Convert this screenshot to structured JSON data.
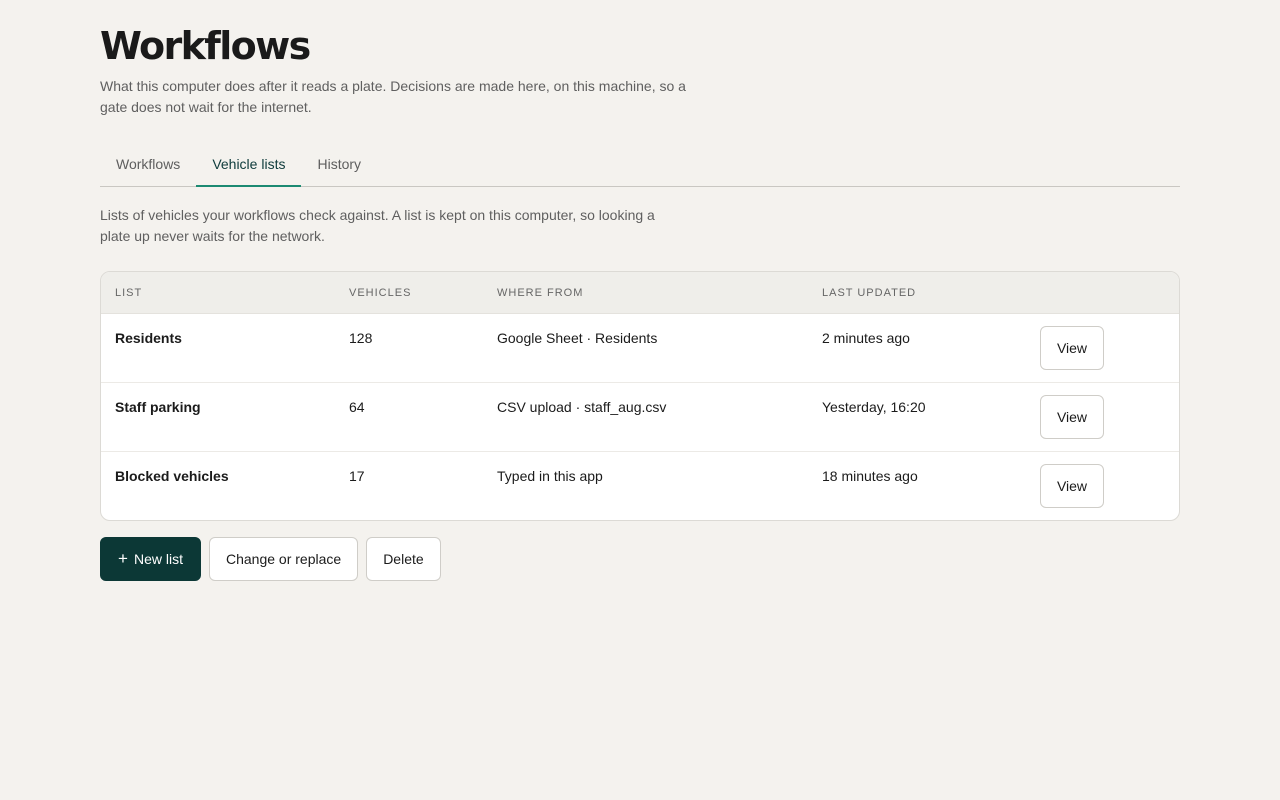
{
  "header": {
    "title": "Workflows",
    "intro": "What this computer does after it reads a plate. Decisions are made here, on this machine, so a gate does not wait for the internet."
  },
  "tabs": [
    {
      "label": "Workflows",
      "active": false
    },
    {
      "label": "Vehicle lists",
      "active": true
    },
    {
      "label": "History",
      "active": false
    }
  ],
  "section": {
    "description": "Lists of vehicles your workflows check against. A list is kept on this computer, so looking a plate up never waits for the network."
  },
  "table": {
    "headers": {
      "list": "LIST",
      "vehicles": "VEHICLES",
      "where_from": "WHERE FROM",
      "last_updated": "LAST UPDATED"
    },
    "rows": [
      {
        "name": "Residents",
        "vehicles": "128",
        "where_from": "Google Sheet · Residents",
        "last_updated": "2 minutes ago",
        "action": "View"
      },
      {
        "name": "Staff parking",
        "vehicles": "64",
        "where_from": "CSV upload · staff_aug.csv",
        "last_updated": "Yesterday, 16:20",
        "action": "View"
      },
      {
        "name": "Blocked vehicles",
        "vehicles": "17",
        "where_from": "Typed in this app",
        "last_updated": "18 minutes ago",
        "action": "View"
      }
    ]
  },
  "actions": {
    "new_list": "New list",
    "new_list_icon": "plus-icon",
    "change_or_replace": "Change or replace",
    "delete": "Delete"
  },
  "colors": {
    "accent": "#1c8a72",
    "primary_button": "#0c3836",
    "background": "#f4f2ee"
  }
}
